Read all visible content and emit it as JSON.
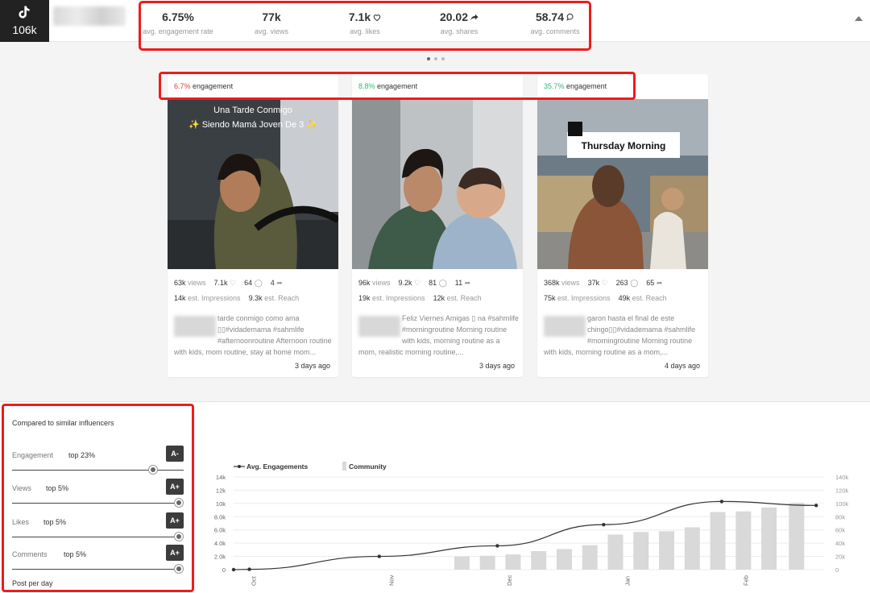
{
  "profile": {
    "followers": "106k"
  },
  "stats": [
    {
      "value": "6.75%",
      "label": "avg. engagement rate",
      "icon": ""
    },
    {
      "value": "77k",
      "label": "avg. views",
      "icon": ""
    },
    {
      "value": "7.1k",
      "label": "avg. likes",
      "icon": "heart-icon"
    },
    {
      "value": "20.02",
      "label": "avg. shares",
      "icon": "share-icon"
    },
    {
      "value": "58.74",
      "label": "avg. comments",
      "icon": "comment-icon"
    }
  ],
  "posts": [
    {
      "engagement_pct": "6.7%",
      "engagement_label": "engagement",
      "pct_color": "red",
      "overlay_text": [
        "Una Tarde Conmigo",
        "✨ Siendo Mamá Joven De 3 ✨"
      ],
      "views": "63k",
      "views_label": "views",
      "likes": "7.1k",
      "comments": "64",
      "shares": "4",
      "impressions": "14k",
      "impressions_label": "est. Impressions",
      "reach": "9.3k",
      "reach_label": "est. Reach",
      "desc": "tarde conmigo como ama ▯▯#vidademama #sahmlife #afternoonroutine Afternoon routine with kids, mom routine, stay at home mom...",
      "ago": "3 days ago"
    },
    {
      "engagement_pct": "8.8%",
      "engagement_label": "engagement",
      "pct_color": "green",
      "overlay_text": [],
      "views": "96k",
      "views_label": "views",
      "likes": "9.2k",
      "comments": "81",
      "shares": "11",
      "impressions": "19k",
      "impressions_label": "est. Impressions",
      "reach": "12k",
      "reach_label": "est. Reach",
      "desc": "Feliz Viernes Amigas ▯ na #sahmlife #morningroutine Morning routine with kids, morning routine as a mom, realistic morning routine,...",
      "ago": "3 days ago"
    },
    {
      "engagement_pct": "35.7%",
      "engagement_label": "engagement",
      "pct_color": "green",
      "overlay_text": [
        "Thursday Morning"
      ],
      "views": "368k",
      "views_label": "views",
      "likes": "37k",
      "comments": "263",
      "shares": "65",
      "impressions": "75k",
      "impressions_label": "est. Impressions",
      "reach": "49k",
      "reach_label": "est. Reach",
      "desc": "garon hasta el final de este chingo▯▯#vidademama #sahmlife #morningroutine Morning routine with kids, morning routine as a mom,...",
      "ago": "4 days ago"
    }
  ],
  "comparison": {
    "title": "Compared to similar influencers",
    "rows": [
      {
        "name": "Engagement",
        "top": "top 23%",
        "grade": "A-",
        "level": 0.82
      },
      {
        "name": "Views",
        "top": "top 5%",
        "grade": "A+",
        "level": 0.97
      },
      {
        "name": "Likes",
        "top": "top 5%",
        "grade": "A+",
        "level": 0.97
      },
      {
        "name": "Comments",
        "top": "top 5%",
        "grade": "A+",
        "level": 0.97
      }
    ],
    "post_per_day": "Post per day"
  },
  "chart_data": {
    "type": "line",
    "legend": [
      "Avg. Engagements",
      "Community"
    ],
    "left_ticks": [
      "0",
      "2.0k",
      "4.0k",
      "6.0k",
      "8.0k",
      "10k",
      "12k",
      "14k"
    ],
    "right_ticks": [
      "0",
      "20k",
      "40k",
      "60k",
      "80k",
      "100k",
      "120k",
      "140k"
    ],
    "x_labels": [
      "Oct",
      "Nov",
      "Dec",
      "Jan",
      "Feb"
    ],
    "ylim_left": [
      0,
      14000
    ],
    "ylim_right": [
      0,
      140000
    ],
    "engagement_series": {
      "name": "Avg. Engagements",
      "x": [
        0,
        0.4,
        3.7,
        6.7,
        9.4,
        12.4,
        14.8
      ],
      "y": [
        0,
        50,
        2000,
        3600,
        6800,
        10300,
        9700
      ]
    },
    "community_series": {
      "name": "Community",
      "x": [
        5.8,
        6.7,
        7.4,
        8.2,
        9.0,
        9.8,
        10.6,
        11.4,
        12.2,
        13.0,
        13.8,
        14.8
      ],
      "y": [
        20000,
        21000,
        23000,
        28000,
        31000,
        37000,
        53000,
        57000,
        58000,
        64000,
        87000,
        88000,
        94000,
        101000
      ]
    },
    "x_label_pos": [
      0.5,
      4.0,
      7.0,
      10.0,
      13.0
    ]
  }
}
